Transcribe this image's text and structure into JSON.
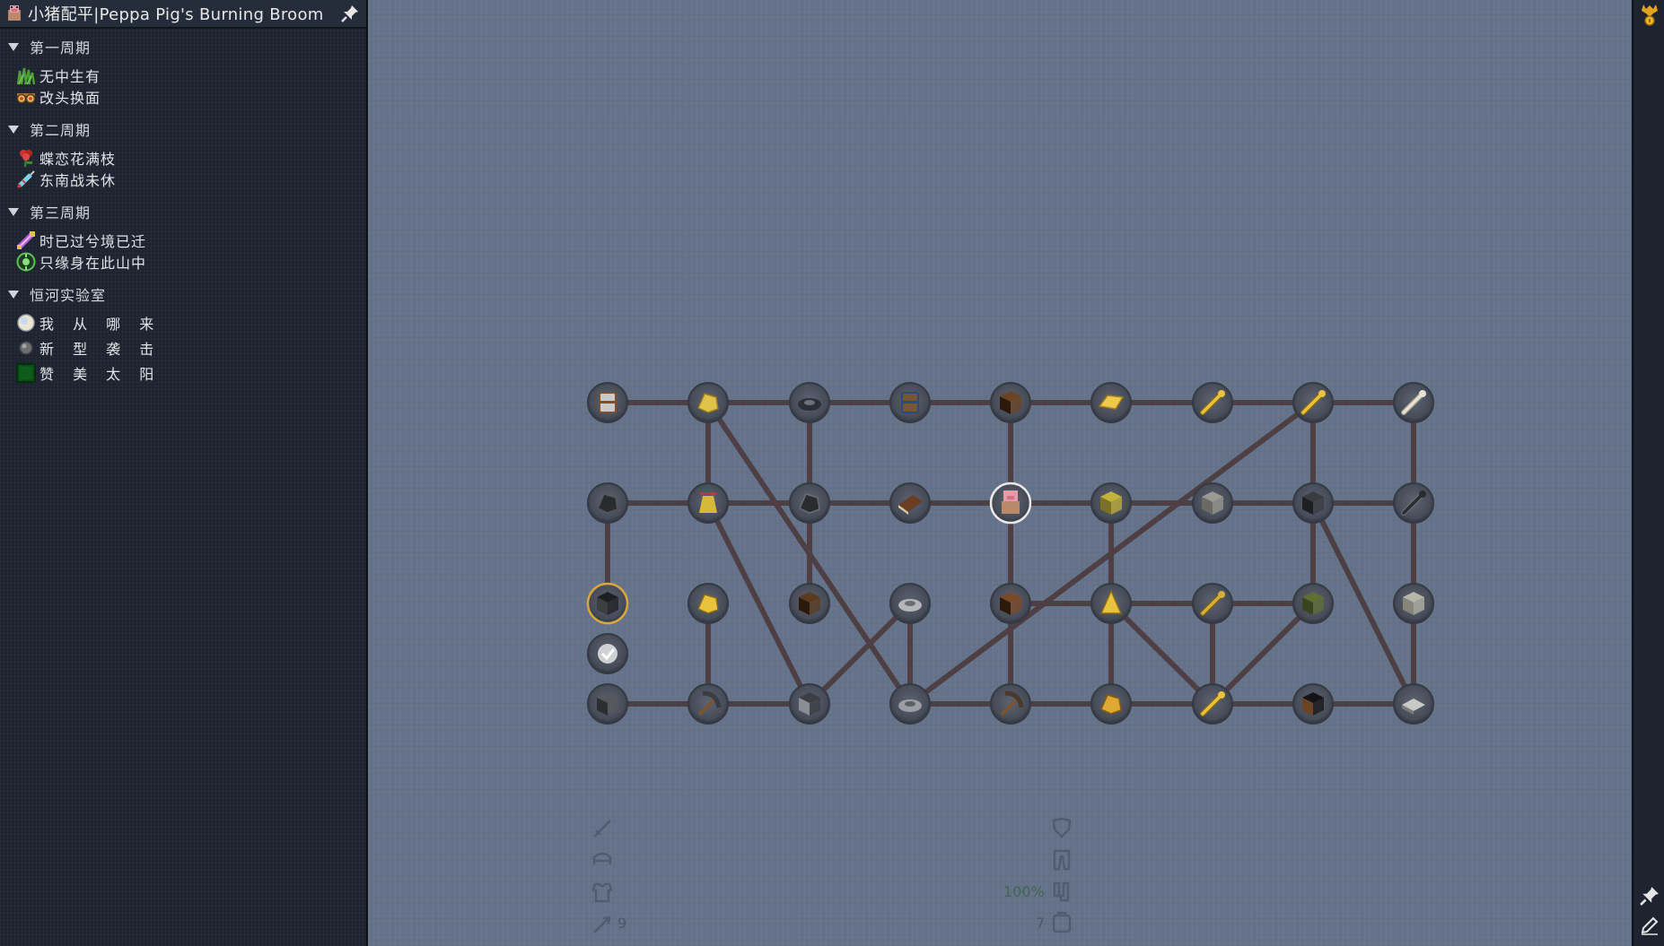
{
  "window": {
    "title": "小猪配平|Peppa Pig's Burning Broom"
  },
  "sidebar": {
    "chapters": [
      {
        "label": "第一周期",
        "quests": [
          {
            "label": "无中生有",
            "icon": "grass-icon"
          },
          {
            "label": "改头换面",
            "icon": "glasses-icon"
          }
        ]
      },
      {
        "label": "第二周期",
        "quests": [
          {
            "label": "蝶恋花满枝",
            "icon": "flower-icon"
          },
          {
            "label": "东南战未休",
            "icon": "syringe-icon"
          }
        ]
      },
      {
        "label": "第三周期",
        "quests": [
          {
            "label": "时已过兮境已迁",
            "icon": "potion-icon"
          },
          {
            "label": "只缘身在此山中",
            "icon": "green-orb-icon"
          }
        ]
      },
      {
        "label": "恒河实验室",
        "quests": [
          {
            "label": "我 从 哪 来",
            "icon": "white-orb-icon"
          },
          {
            "label": "新 型 袭 击",
            "icon": "grey-orb-icon"
          },
          {
            "label": "赞 美 太 阳",
            "icon": "green-block-icon"
          }
        ]
      }
    ]
  },
  "hud": {
    "durability_text": "100%",
    "count_left": "9",
    "count_right": "7"
  },
  "colors": {
    "background": "#65738a",
    "sidebar": "#1d2430",
    "link": "#4e3f44",
    "node_fill": "#505663",
    "node_highlight": "#d8a640"
  },
  "map": {
    "nodes": [
      {
        "id": "r0c0",
        "icon": "bucket-icon"
      },
      {
        "id": "r0c1",
        "icon": "gold-dust-icon"
      },
      {
        "id": "r0c2",
        "icon": "dark-ring-icon"
      },
      {
        "id": "r0c3",
        "icon": "barrel-icon"
      },
      {
        "id": "r0c4",
        "icon": "chest-icon"
      },
      {
        "id": "r0c5",
        "icon": "gold-ingot-icon"
      },
      {
        "id": "r0c6",
        "icon": "gold-wrench-icon"
      },
      {
        "id": "r0c7",
        "icon": "gold-staff-icon"
      },
      {
        "id": "r0c8",
        "icon": "bone-icon"
      },
      {
        "id": "r1c0",
        "icon": "coal-icon"
      },
      {
        "id": "r1c1",
        "icon": "sulfur-jar-icon"
      },
      {
        "id": "r1c2",
        "icon": "dark-hook-icon"
      },
      {
        "id": "r1c3",
        "icon": "book-icon"
      },
      {
        "id": "r1c4",
        "icon": "pig-icon"
      },
      {
        "id": "r1c5",
        "icon": "hay-block-icon"
      },
      {
        "id": "r1c6",
        "icon": "stone-block-icon"
      },
      {
        "id": "r1c7",
        "icon": "dark-block-icon"
      },
      {
        "id": "r1c8",
        "icon": "dark-rod-icon"
      },
      {
        "id": "r2c0",
        "icon": "black-block-icon"
      },
      {
        "id": "r2c1",
        "icon": "gold-nugget-icon"
      },
      {
        "id": "r2c2",
        "icon": "crate-icon"
      },
      {
        "id": "r2c3",
        "icon": "grey-dish-icon"
      },
      {
        "id": "r2c4",
        "icon": "wood-crate-icon"
      },
      {
        "id": "r2c5",
        "icon": "gold-cone-icon"
      },
      {
        "id": "r2c6",
        "icon": "gold-rod-icon"
      },
      {
        "id": "r2c7",
        "icon": "moss-block-icon"
      },
      {
        "id": "r2c8",
        "icon": "pale-block-icon"
      },
      {
        "id": "r3c0",
        "icon": "check-icon"
      },
      {
        "id": "r4c0",
        "icon": "grey-cube-icon"
      },
      {
        "id": "r4c1",
        "icon": "pickaxe-icon"
      },
      {
        "id": "r4c2",
        "icon": "ore-block-icon"
      },
      {
        "id": "r4c3",
        "icon": "dish-icon"
      },
      {
        "id": "r4c4",
        "icon": "hammer-icon"
      },
      {
        "id": "r4c5",
        "icon": "gold-ore-icon"
      },
      {
        "id": "r4c6",
        "icon": "gold-feather-icon"
      },
      {
        "id": "r4c7",
        "icon": "obsidian-icon"
      },
      {
        "id": "r4c8",
        "icon": "slab-icon"
      }
    ]
  }
}
